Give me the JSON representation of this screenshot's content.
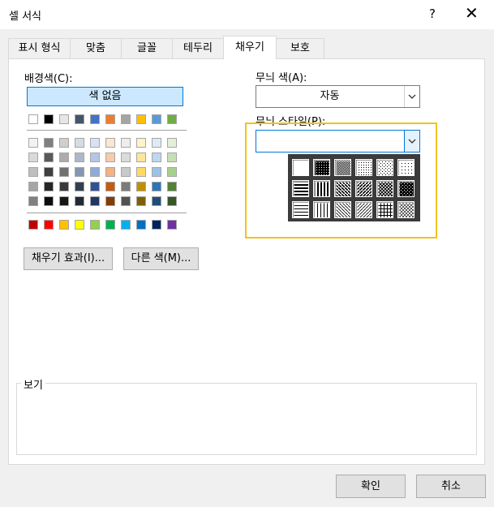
{
  "window": {
    "title": "셀 서식",
    "help": "?",
    "close": "✕"
  },
  "tabs": [
    {
      "label": "표시 형식"
    },
    {
      "label": "맞춤"
    },
    {
      "label": "글꼴"
    },
    {
      "label": "테두리"
    },
    {
      "label": "채우기"
    },
    {
      "label": "보호"
    }
  ],
  "fill": {
    "background_label": "배경색(C):",
    "no_color": "색 없음",
    "fill_effects": "채우기 효과(I)...",
    "more_colors": "다른 색(M)...",
    "pattern_color_label": "무늬 색(A):",
    "pattern_color_value": "자동",
    "pattern_style_label": "무늬 스타일(P):",
    "pattern_style_value": ""
  },
  "palette": {
    "theme_top": [
      "#ffffff",
      "#000000",
      "#e7e6e6",
      "#44546a",
      "#4472c4",
      "#ed7d31",
      "#a5a5a5",
      "#ffc000",
      "#5b9bd5",
      "#70ad47"
    ],
    "theme_shades": [
      [
        "#f2f2f2",
        "#7f7f7f",
        "#d0cece",
        "#d6dce4",
        "#d9e2f3",
        "#fbe5d5",
        "#ededed",
        "#fff2cc",
        "#deebf6",
        "#e2efd9"
      ],
      [
        "#d9d9d9",
        "#595959",
        "#aeabab",
        "#adb9ca",
        "#b4c6e7",
        "#f7cbac",
        "#dbdbdb",
        "#fee599",
        "#bdd7ee",
        "#c5e0b3"
      ],
      [
        "#bfbfbf",
        "#404040",
        "#757070",
        "#8496b0",
        "#8eaadb",
        "#f4b183",
        "#c9c9c9",
        "#ffd966",
        "#9cc3e5",
        "#a8d08d"
      ],
      [
        "#a6a6a6",
        "#262626",
        "#3a3838",
        "#323f4f",
        "#2f5496",
        "#c55a11",
        "#7b7b7b",
        "#bf9000",
        "#2e75b5",
        "#538135"
      ],
      [
        "#808080",
        "#0d0d0d",
        "#161616",
        "#222a35",
        "#1f3864",
        "#833c0b",
        "#525252",
        "#7f6000",
        "#1e4e79",
        "#375623"
      ]
    ],
    "standard": [
      "#c00000",
      "#ff0000",
      "#ffc000",
      "#ffff00",
      "#92d050",
      "#00b050",
      "#00b0f0",
      "#0070c0",
      "#002060",
      "#7030a0"
    ]
  },
  "pattern_popup": {
    "patterns": [
      "solid",
      "gray-75",
      "gray-50",
      "gray-25",
      "gray-12",
      "gray-6",
      "horizontal-stripe",
      "vertical-stripe",
      "reverse-diagonal",
      "diagonal",
      "diagonal-crosshatch",
      "thick-crosshatch",
      "thin-horizontal",
      "thin-vertical",
      "thin-reverse-diagonal",
      "thin-diagonal",
      "thin-horizontal-crosshatch",
      "thin-diagonal-crosshatch"
    ]
  },
  "preview": {
    "label": "보기"
  },
  "footer": {
    "ok": "확인",
    "cancel": "취소"
  }
}
